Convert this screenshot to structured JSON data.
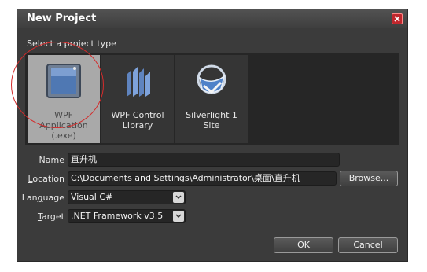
{
  "dialog": {
    "title": "New Project",
    "section_label": "Select a project type"
  },
  "project_types": [
    {
      "label": "WPF\nApplication\n(.exe)",
      "icon": "wpf-application-icon",
      "selected": true
    },
    {
      "label": "WPF Control\nLibrary",
      "icon": "wpf-control-library-icon",
      "selected": false
    },
    {
      "label": "Silverlight 1\nSite",
      "icon": "silverlight-icon",
      "selected": false
    }
  ],
  "fields": {
    "name": {
      "label": "Name",
      "accel": "N",
      "rest": "ame",
      "value": "直升机"
    },
    "location": {
      "label": "Location",
      "accel": "L",
      "rest": "ocation",
      "value": "C:\\Documents and Settings\\Administrator\\桌面\\直升机",
      "browse": "Browse..."
    },
    "language": {
      "label": "Language",
      "pre": "Lan",
      "accel": "g",
      "rest": "uage",
      "value": "Visual C#"
    },
    "target": {
      "label": "Target",
      "accel": "T",
      "rest": "arget",
      "value": ".NET Framework v3.5"
    }
  },
  "buttons": {
    "ok": "OK",
    "cancel": "Cancel"
  },
  "colors": {
    "dialog_bg": "#3b3b3b",
    "panel_bg": "#262626",
    "selected_tile": "#a9a9a9",
    "close_red": "#c0272d",
    "annotation_red": "#d42b2b"
  }
}
